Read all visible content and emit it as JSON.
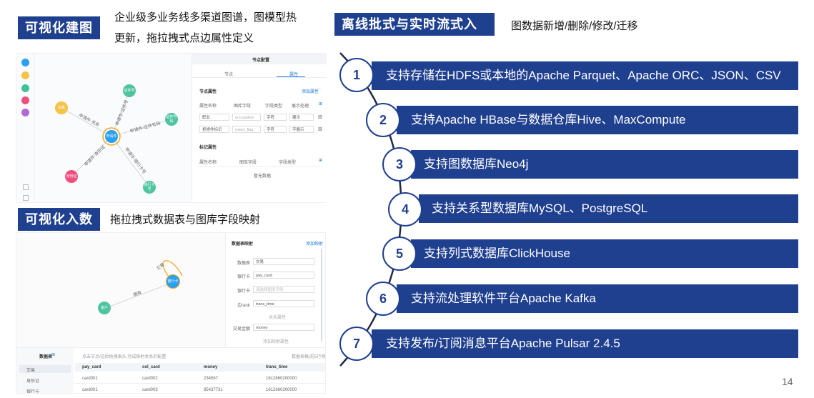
{
  "sec1": {
    "tag": "可视化建图",
    "desc_line1": "企业级多业务线多渠道图谱，图模型热",
    "desc_line2": "更新，拖拉拽式点边属性定义"
  },
  "sec2": {
    "tag": "可视化入数",
    "desc": "拖拉拽式数据表与图库字段映射"
  },
  "sec3": {
    "tag": "离线批式与实时流式入数",
    "desc": "图数据新增/删除/修改/迁移"
  },
  "page_number": "14",
  "legend_colors": [
    "#2aa0f0",
    "#f5c24a",
    "#3ec39a",
    "#ee4f7d",
    "#b06ad6"
  ],
  "graph1": {
    "nodes": [
      {
        "label": "关系",
        "color": "#f5c24a"
      },
      {
        "label": "证件号",
        "color": "#4fc49e"
      },
      {
        "label": "申请件",
        "color": "#2aa0f0"
      },
      {
        "label": "证件号码",
        "color": "#4fc49e"
      },
      {
        "label": "身份证",
        "color": "#ee4f7d"
      },
      {
        "label": "银行卡号",
        "color": "#4fc49e"
      }
    ],
    "edge_labels": [
      "申请件-关系",
      "申请件-证件号",
      "申请件-证件号码",
      "申请件-身份证",
      "申请件-银行卡号"
    ]
  },
  "config1": {
    "title": "节点配置",
    "tab1": "节点",
    "tab2": "属性",
    "props_title": "节点属性",
    "add_attr": "添加属性",
    "more": "···",
    "columns": [
      "属性名称",
      "图库字段",
      "字段类型",
      "展示处理"
    ],
    "rows": [
      {
        "name": "职业",
        "field": "occupation",
        "type": "字符",
        "show": "展示"
      },
      {
        "name": "拒绝件标识",
        "field": "reject_flag",
        "type": "字符",
        "show": "不展示"
      }
    ],
    "tag_title": "标记属性",
    "tag_columns": [
      "属性名称",
      "图库字段",
      "字段类型"
    ],
    "empty": "暂无数据"
  },
  "graph2": {
    "nodes": [
      {
        "label": "银行卡",
        "color": "#2aa0f0"
      },
      {
        "label": "客户",
        "color": "#4fc49e"
      }
    ],
    "loop_label": "交易",
    "edge_label": "拥有"
  },
  "config2": {
    "title": "数据表映射",
    "add_map": "添加映射",
    "fields": [
      {
        "label": "数据表",
        "value": "交易"
      },
      {
        "label": "银行卡",
        "value": "pay_card"
      },
      {
        "label": "银行卡",
        "value": "请选择图库字段"
      },
      {
        "label": "边rank",
        "value": "trans_time"
      }
    ],
    "link1": "关系属性",
    "amount_label": "交易金额",
    "amount_value": "money",
    "link2": "添加映射属性"
  },
  "table": {
    "side_title": "数据表",
    "side_items": [
      "交易",
      "身份证",
      "银行卡"
    ],
    "hint": "点击节点/边后拖拽表头,完成映射关系的配置",
    "right_hint": "数据表格(前5行预览)",
    "columns": [
      "pay_card",
      "col_card",
      "money",
      "trans_time"
    ],
    "rows": [
      [
        "card001",
        "card002",
        "234567",
        "1612660200000"
      ],
      [
        "card001",
        "card003",
        "85437731",
        "1612660200000"
      ]
    ]
  },
  "steps": [
    {
      "num": "1",
      "text": "支持存储在HDFS或本地的Apache Parquet、Apache ORC、JSON、CSV"
    },
    {
      "num": "2",
      "text": "支持Apache HBase与数据仓库Hive、MaxCompute"
    },
    {
      "num": "3",
      "text": "支持图数据库Neo4j"
    },
    {
      "num": "4",
      "text": "支持关系型数据库MySQL、PostgreSQL"
    },
    {
      "num": "5",
      "text": "支持列式数据库ClickHouse"
    },
    {
      "num": "6",
      "text": "支持流处理软件平台Apache Kafka"
    },
    {
      "num": "7",
      "text": "支持发布/订阅消息平台Apache Pulsar 2.4.5"
    }
  ]
}
